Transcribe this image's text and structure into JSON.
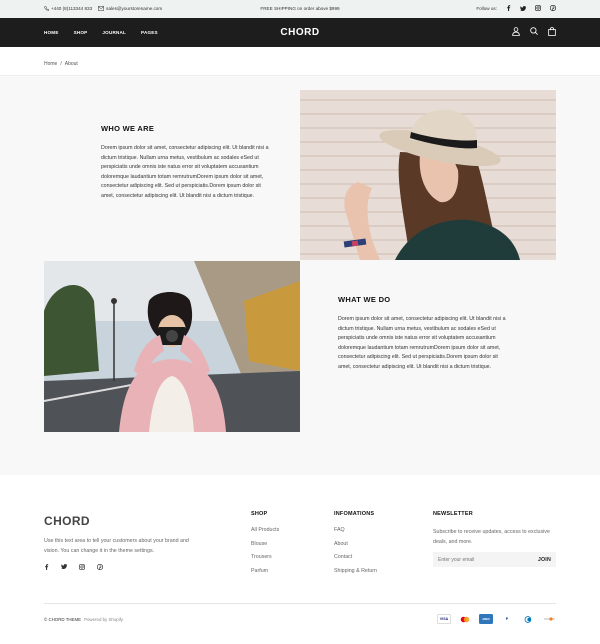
{
  "topbar": {
    "phone": "+440 (8)113344 833",
    "email": "sales@yourstorename.com",
    "shipping": "FREE SHIPPING on order above $999",
    "follow_label": "Follow us:",
    "social_icons": [
      "facebook-icon",
      "twitter-icon",
      "instagram-icon",
      "pinterest-icon"
    ]
  },
  "nav": {
    "logo": "CHORD",
    "menu": [
      "HOME",
      "SHOP",
      "JOURNAL",
      "PAGES"
    ],
    "icons": [
      "user-icon",
      "search-icon",
      "bag-icon"
    ]
  },
  "breadcrumb": {
    "home": "Home",
    "separator": "/",
    "current": "About"
  },
  "sections": {
    "who": {
      "title": "WHO WE ARE",
      "text": "Dorem ipsum dolor sit amet, consectetur adipiscing elit. Ut blandit nisi a dictum tristique. Nullam urna metus, vestibulum ac sodales eSed ut perspiciatis unde omnis iste natus error sit voluptatem accusantium doloremque laudantium totam remrutrumDorem ipsum dolor sit amet, consectetur adipiscing elit. Sed ut perspiciatis.Dorem ipsum dolor sit amet, consectetur adipiscing elit. Ut blandit nisi a dictum tristique."
    },
    "what": {
      "title": "WHAT WE DO",
      "text": "Dorem ipsum dolor sit amet, consectetur adipiscing elit. Ut blandit nisi a dictum tristique. Nullam urna metus, vestibulum ac sodales eSed ut perspiciatis unde omnis iste natus error sit voluptatem accusantium doloremque laudantium totam remrutrumDorem ipsum dolor sit amet, consectetur adipiscing elit. Sed ut perspiciatis.Dorem ipsum dolor sit amet, consectetur adipiscing elit. Ut blandit nisi a dictum tristique."
    }
  },
  "footer": {
    "logo": "CHORD",
    "description": "Use this text area to tell your customers about your brand and vision. You can change it in the theme settings.",
    "social_icons": [
      "facebook-icon",
      "twitter-icon",
      "instagram-icon",
      "pinterest-icon"
    ],
    "shop": {
      "title": "SHOP",
      "items": [
        "All Products",
        "Blouse",
        "Trousers",
        "Parfum"
      ]
    },
    "info": {
      "title": "INFOMATIONS",
      "items": [
        "FAQ",
        "About",
        "Contact",
        "Shipping & Return"
      ]
    },
    "newsletter": {
      "title": "NEWSLETTER",
      "text": "Subscribe to receive updates, access to exclusive deals, and more.",
      "placeholder": "Enter your email",
      "button": "JOIN"
    },
    "copyright": "© CHORD THEME",
    "powered": "Powered by Shopify",
    "payments": [
      {
        "name": "VISA",
        "color": "#1a1f71"
      },
      {
        "name": "mastercard",
        "color": "#eb001b"
      },
      {
        "name": "AMEX",
        "color": "#2e77bb"
      },
      {
        "name": "P",
        "color": "#003087"
      },
      {
        "name": "diners",
        "color": "#0079be"
      },
      {
        "name": "discover",
        "color": "#f58220"
      }
    ]
  }
}
